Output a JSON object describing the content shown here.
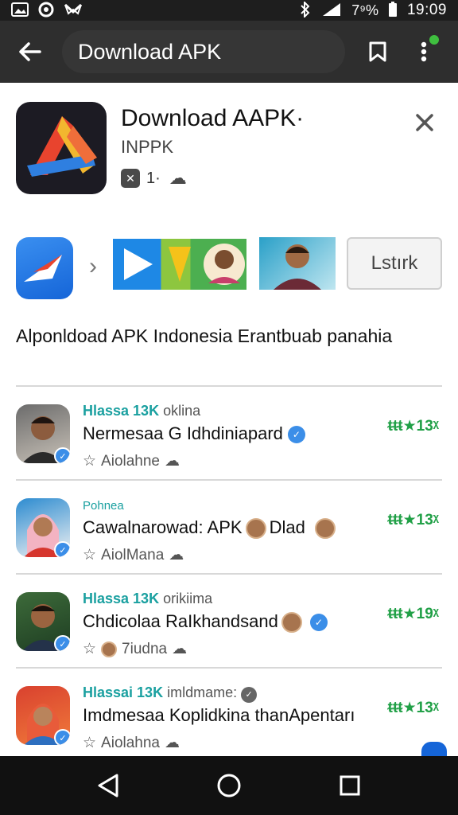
{
  "status_bar": {
    "left_icons": [
      "gallery-icon",
      "circle-app-icon",
      "email-icon"
    ],
    "battery_text": "7⁹%",
    "time": "19:09"
  },
  "app_bar": {
    "title": "Download APK"
  },
  "app_header": {
    "title": "Download AAPK·",
    "subtitle": "INPPK",
    "meta_text": "1·"
  },
  "screenshots": {
    "button_label": "Lstırk"
  },
  "description": "Alponldoad APK Indonesia Erantbuab panahia",
  "list": [
    {
      "top_accent": "Hlassa 13K",
      "top_text": "oklina",
      "title": "Nermesaa G Idhdiniapard",
      "sub": "Aiolahne",
      "rating": "ᵵᵵᵵ★13ᵡ"
    },
    {
      "top_accent": "Pohnea",
      "top_text": "",
      "title": "Cawalnarowad: APK",
      "title_extra": "Dlad",
      "sub": "AiolMana",
      "rating": "ᵵᵵᵵ★13ᵡ"
    },
    {
      "top_accent": "Hlassa 13K",
      "top_text": "orikiima",
      "title": "Chdicolaa RaIkhandsand",
      "sub": "7iudna",
      "rating": "ᵵᵵᵵ★19ᵡ"
    },
    {
      "top_accent": "Hlassai 13K",
      "top_text": "imldmame:",
      "title": "Imdmesaa Koplidkina thanApentarı",
      "sub": "Aiolahna",
      "rating": "ᵵᵵᵵ★13ᵡ"
    }
  ]
}
